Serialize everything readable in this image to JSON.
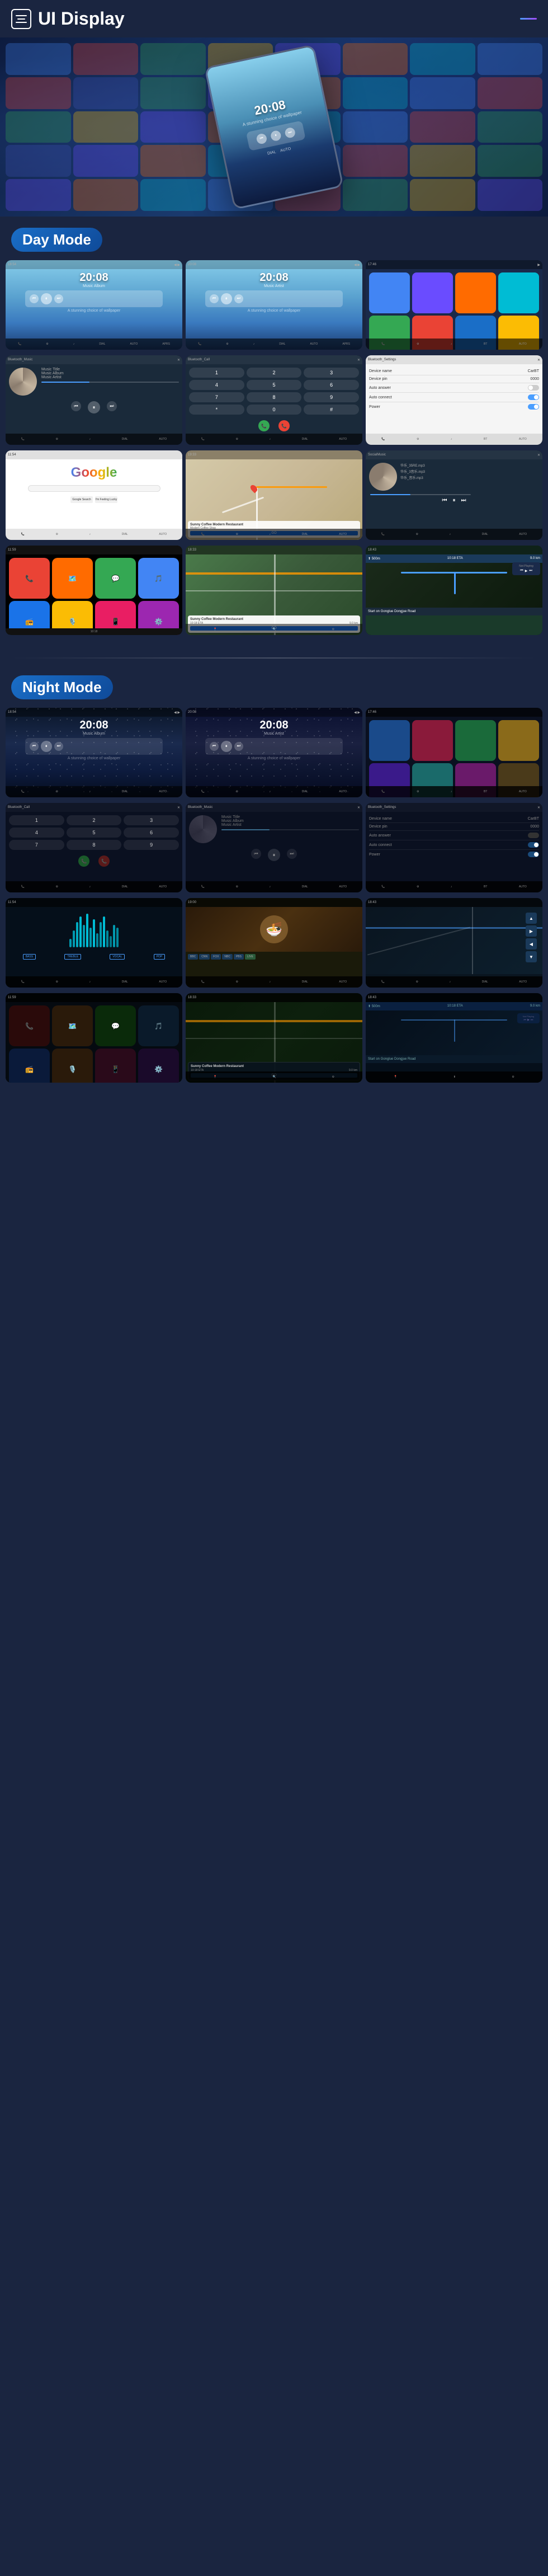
{
  "header": {
    "title": "UI Display",
    "menu_label": "menu",
    "nav_label": "navigation"
  },
  "sections": {
    "day_mode": "Day Mode",
    "night_mode": "Night Mode"
  },
  "screens": {
    "time": "20:08",
    "music_title": "Music Title",
    "music_album": "Music Album",
    "music_artist": "Music Artist",
    "bluetooth_music": "Bluetooth_Music",
    "bluetooth_call": "Bluetooth_Call",
    "bluetooth_settings": "Bluetooth_Settings",
    "device_name_label": "Device name",
    "device_name_val": "CarBT",
    "device_pin_label": "Device pin",
    "device_pin_val": "0000",
    "auto_answer_label": "Auto answer",
    "auto_connect_label": "Auto connect",
    "power_label": "Power",
    "social_music": "SocialMusic",
    "google": "Google",
    "sunny_coffee": "Sunny Coffee Modern Restaurant",
    "sunny_coffee_address": "Modern Restaurant Address Here",
    "eta_label": "10:18 ETA",
    "distance_label": "9.0 km",
    "go_label": "GO",
    "start_label": "Start on Gonglue Dongjue Road",
    "not_playing": "Not Playing",
    "file1": "华乐_35RE.mp3",
    "file2": "华乐_音乐.mp3"
  },
  "colors": {
    "accent_blue": "#4a9eff",
    "accent_purple": "#6a4cff",
    "bg_dark": "#1a2540",
    "day_sky": "#87ceeb",
    "night_sky": "#0a1628"
  }
}
